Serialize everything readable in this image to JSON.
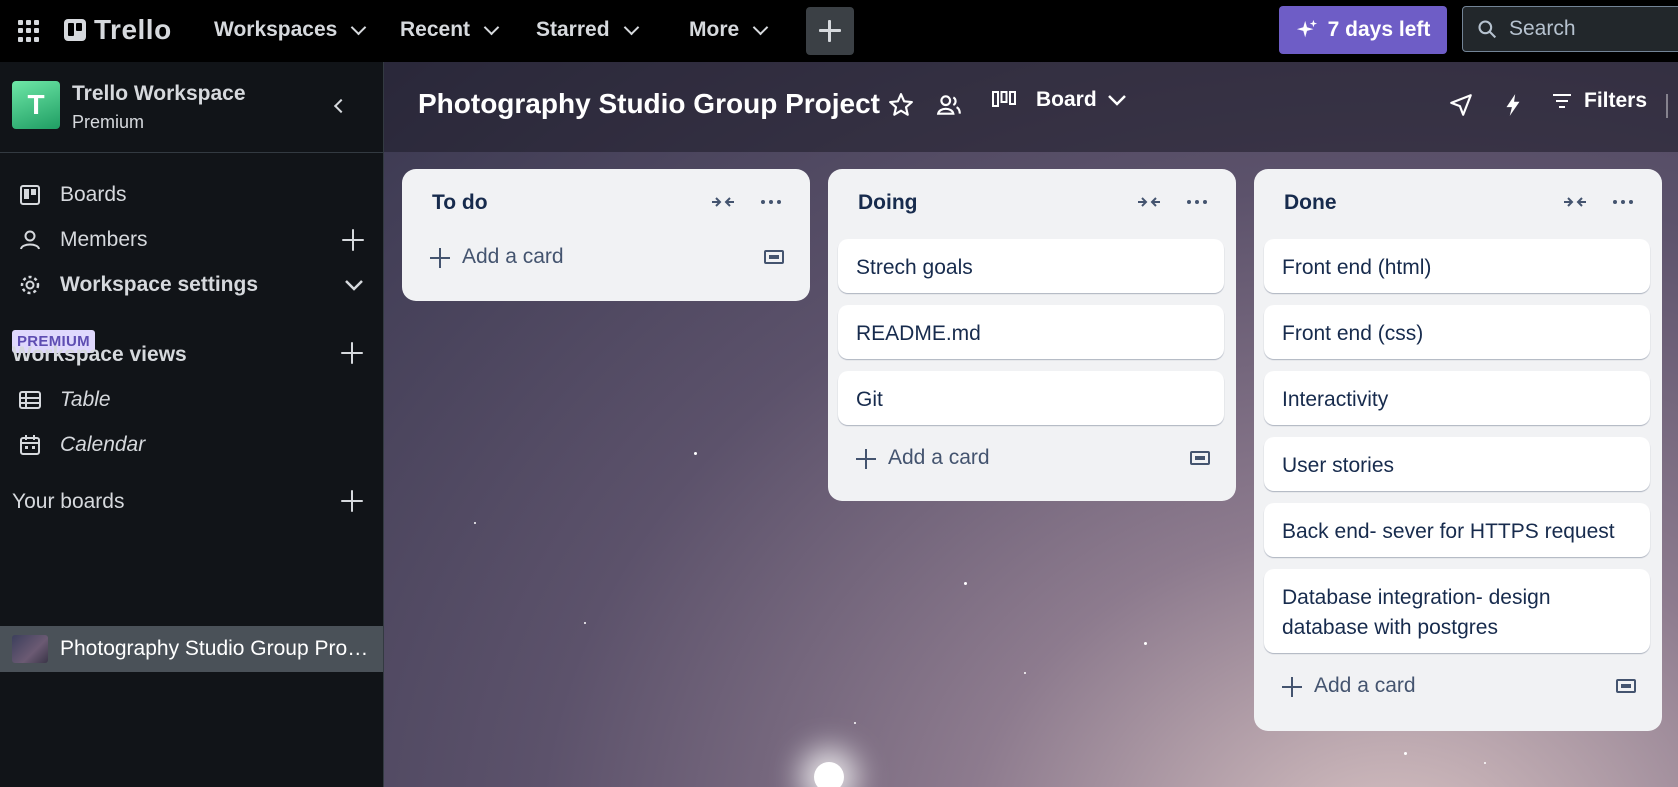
{
  "topbar": {
    "logo": "Trello",
    "nav": [
      "Workspaces",
      "Recent",
      "Starred",
      "More"
    ],
    "trial_label": "7 days left",
    "search_placeholder": "Search"
  },
  "sidebar": {
    "workspace_initial": "T",
    "workspace_name": "Trello Workspace",
    "workspace_plan": "Premium",
    "items": [
      {
        "label": "Boards",
        "icon": "board-icon"
      },
      {
        "label": "Members",
        "icon": "person-icon"
      },
      {
        "label": "Workspace settings",
        "icon": "gear-icon"
      }
    ],
    "premium_badge": "PREMIUM",
    "views_title": "Workspace views",
    "views": [
      {
        "label": "Table",
        "icon": "table-icon"
      },
      {
        "label": "Calendar",
        "icon": "calendar-icon"
      }
    ],
    "boards_title": "Your boards",
    "boards": [
      {
        "label": "Photography Studio Group Project"
      }
    ]
  },
  "board": {
    "title": "Photography Studio Group Project",
    "view": "Board",
    "filters_label": "Filters",
    "lists": [
      {
        "title": "To do",
        "cards": [],
        "add_label": "Add a card"
      },
      {
        "title": "Doing",
        "cards": [
          "Strech goals",
          "README.md",
          "Git"
        ],
        "add_label": "Add a card"
      },
      {
        "title": "Done",
        "cards": [
          "Front end (html)",
          "Front end (css)",
          "Interactivity",
          "User stories",
          "Back end- sever for HTTPS request",
          "Database integration- design database with postgres"
        ],
        "add_label": "Add a card"
      }
    ]
  },
  "colors": {
    "accent": "#6e5dc6",
    "sidebar": "#111418",
    "list": "#f1f2f4"
  }
}
